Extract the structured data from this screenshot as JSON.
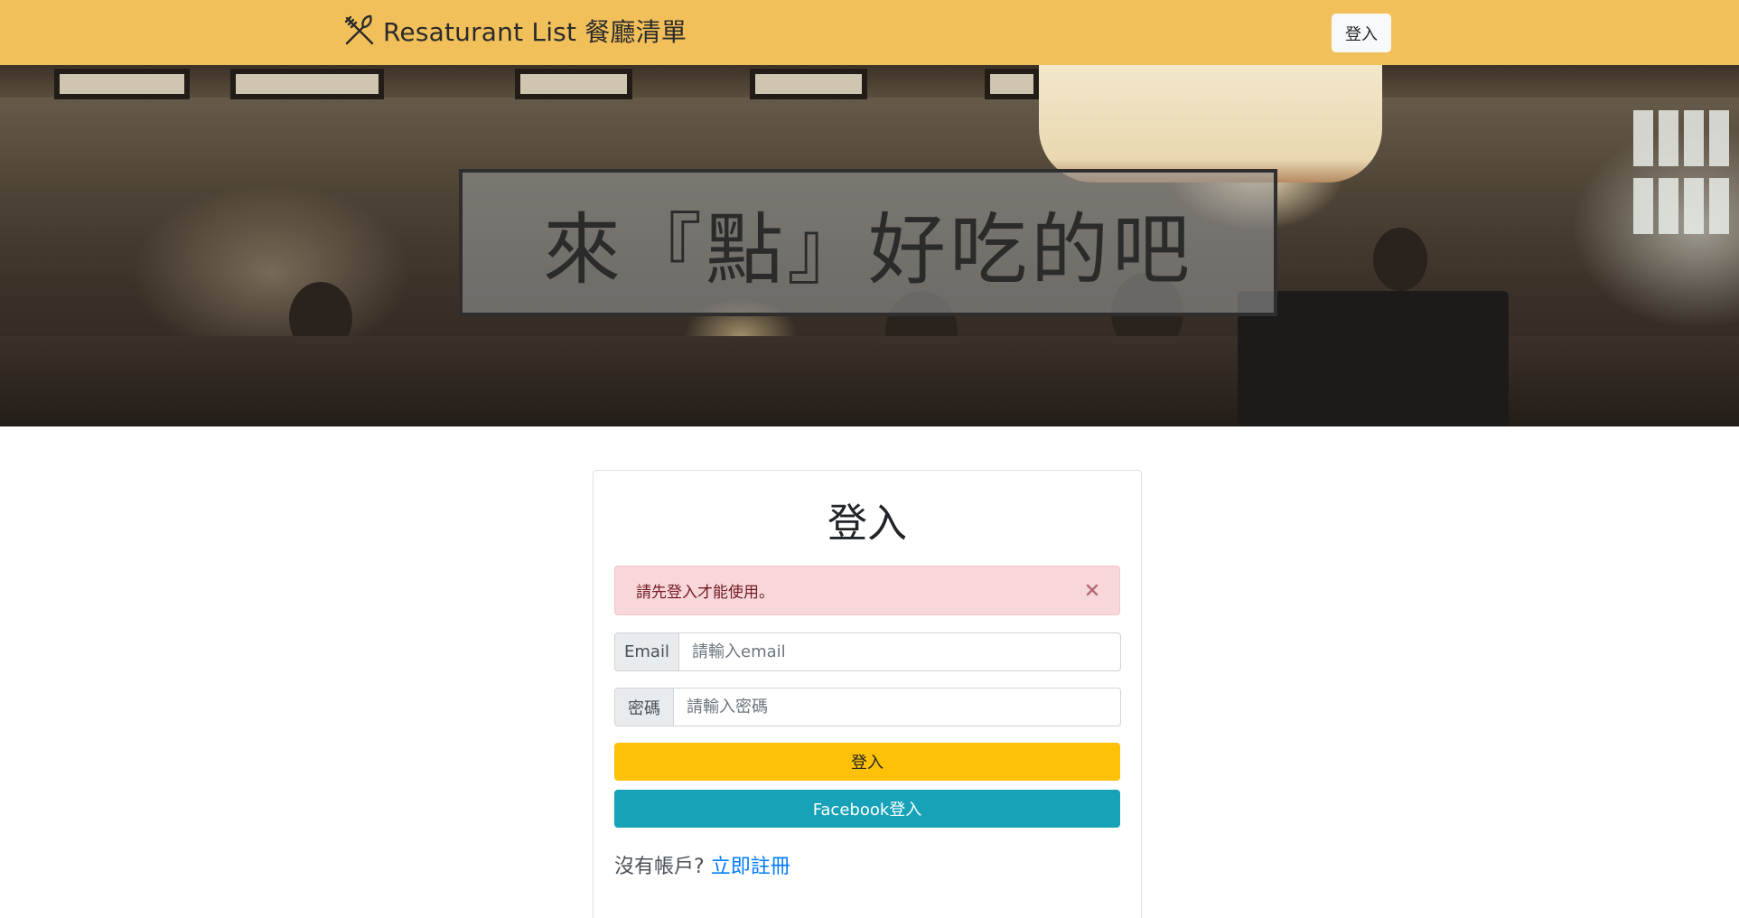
{
  "navbar": {
    "brand_icon": "fork-knife-icon",
    "brand_text": "Resaturant List 餐廳清單",
    "login_button": "登入"
  },
  "hero": {
    "headline": "來『點』好吃的吧"
  },
  "login_card": {
    "title": "登入",
    "alert": {
      "message": "請先登入才能使用。",
      "close_icon": "close-icon"
    },
    "email": {
      "label": "Email",
      "value": "",
      "placeholder": "請輸入email"
    },
    "password": {
      "label": "密碼",
      "value": "",
      "placeholder": "請輸入密碼"
    },
    "submit_button": "登入",
    "facebook_button": "Facebook登入",
    "register_prompt": "沒有帳戶?",
    "register_link": "立即註冊"
  },
  "colors": {
    "navbar_bg": "#f2c05a",
    "alert_bg": "#f8d7da",
    "login_button_bg": "#ffc107",
    "facebook_button_bg": "#17a2b8",
    "link": "#007bff"
  }
}
